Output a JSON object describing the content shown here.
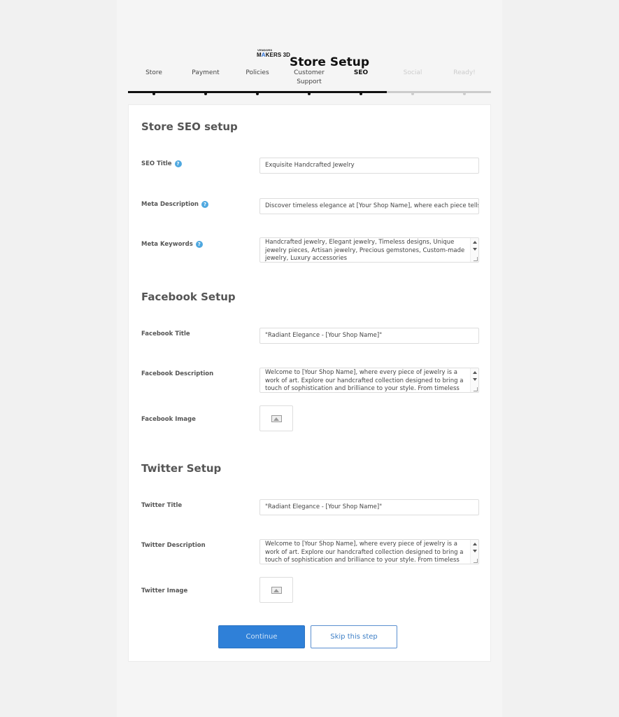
{
  "header": {
    "logo_small": "VENDORS",
    "logo_big_prefix": "M",
    "logo_big_highlight": "A",
    "logo_big_suffix": "KERS 3D",
    "title": "Store Setup"
  },
  "steps": [
    {
      "label": "Store",
      "state": "done"
    },
    {
      "label": "Payment",
      "state": "done"
    },
    {
      "label": "Policies",
      "state": "done"
    },
    {
      "label": "Customer Support",
      "state": "done"
    },
    {
      "label": "SEO",
      "state": "active"
    },
    {
      "label": "Social",
      "state": "todo"
    },
    {
      "label": "Ready!",
      "state": "todo"
    }
  ],
  "seo": {
    "heading": "Store SEO setup",
    "title_label": "SEO Title",
    "title_value": "Exquisite Handcrafted Jewelry",
    "desc_label": "Meta Description",
    "desc_value": "Discover timeless elegance at [Your Shop Name], where each piece tells a s",
    "keywords_label": "Meta Keywords",
    "keywords_value": "Handcrafted jewelry, Elegant jewelry, Timeless designs, Unique jewelry pieces, Artisan jewelry, Precious gemstones, Custom-made jewelry, Luxury accessories"
  },
  "facebook": {
    "heading": "Facebook Setup",
    "title_label": "Facebook Title",
    "title_value": "\"Radiant Elegance - [Your Shop Name]\"",
    "desc_label": "Facebook Description",
    "desc_value": "Welcome to [Your Shop Name], where every piece of jewelry is a work of art. Explore our handcrafted collection designed to bring a touch of sophistication and brilliance to your style. From timeless classics to",
    "image_label": "Facebook Image"
  },
  "twitter": {
    "heading": "Twitter Setup",
    "title_label": "Twitter Title",
    "title_value": "\"Radiant Elegance - [Your Shop Name]\"",
    "desc_label": "Twitter Description",
    "desc_value": "Welcome to [Your Shop Name], where every piece of jewelry is a work of art. Explore our handcrafted collection designed to bring a touch of sophistication and brilliance to your style. From timeless classics to",
    "image_label": "Twitter Image"
  },
  "help_glyph": "?",
  "actions": {
    "continue_label": "Continue",
    "skip_label": "Skip this step"
  },
  "colors": {
    "accent": "#2f80d8",
    "help": "#4fa8e0",
    "progress_done": "#111111",
    "progress_todo": "#cccccc"
  }
}
